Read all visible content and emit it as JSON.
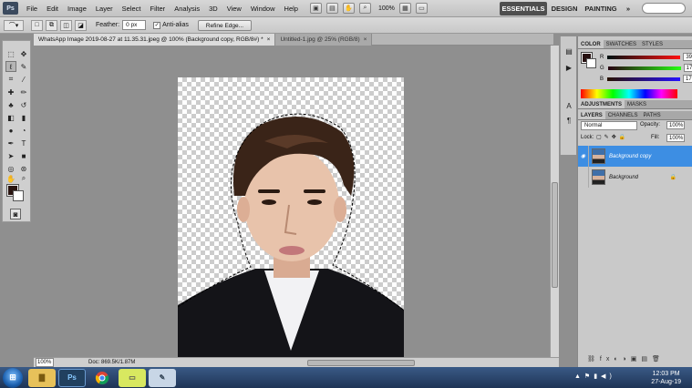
{
  "app": {
    "logo": "Ps"
  },
  "menu": [
    "File",
    "Edit",
    "Image",
    "Layer",
    "Select",
    "Filter",
    "Analysis",
    "3D",
    "View",
    "Window",
    "Help"
  ],
  "menubar": {
    "zoom": "100%",
    "workspaces": [
      "ESSENTIALS",
      "DESIGN",
      "PAINTING"
    ],
    "more": "»"
  },
  "options": {
    "feather_label": "Feather:",
    "feather_value": "0 px",
    "antialias_label": "Anti-alias",
    "refine_button": "Refine Edge..."
  },
  "tabs": [
    {
      "label": "WhatsApp Image 2019-08-27 at 11.35.31.jpeg @ 100% (Background copy, RGB/8#) *",
      "close": "×"
    },
    {
      "label": "Untitled-1.jpg @ 25% (RGB/8)",
      "close": "×"
    }
  ],
  "status": {
    "zoom": "100%",
    "doc": "Doc: 869.5K/1.87M"
  },
  "color_panel": {
    "tabs": [
      "COLOR",
      "SWATCHES",
      "STYLES"
    ],
    "channels": [
      {
        "name": "R",
        "value": "39"
      },
      {
        "name": "G",
        "value": "17"
      },
      {
        "name": "B",
        "value": "17"
      }
    ],
    "fg": "#271111"
  },
  "adjust_panel": {
    "tabs": [
      "ADJUSTMENTS",
      "MASKS"
    ]
  },
  "layers_panel": {
    "tabs": [
      "LAYERS",
      "CHANNELS",
      "PATHS"
    ],
    "blend": "Normal",
    "opacity_label": "Opacity:",
    "opacity": "100%",
    "lock_label": "Lock:",
    "fill_label": "Fill:",
    "fill": "100%",
    "layers": [
      "Background copy",
      "Background"
    ]
  },
  "taskbar": {
    "time": "12:03 PM",
    "date": "27-Aug-19",
    "ps_label": "Ps"
  }
}
